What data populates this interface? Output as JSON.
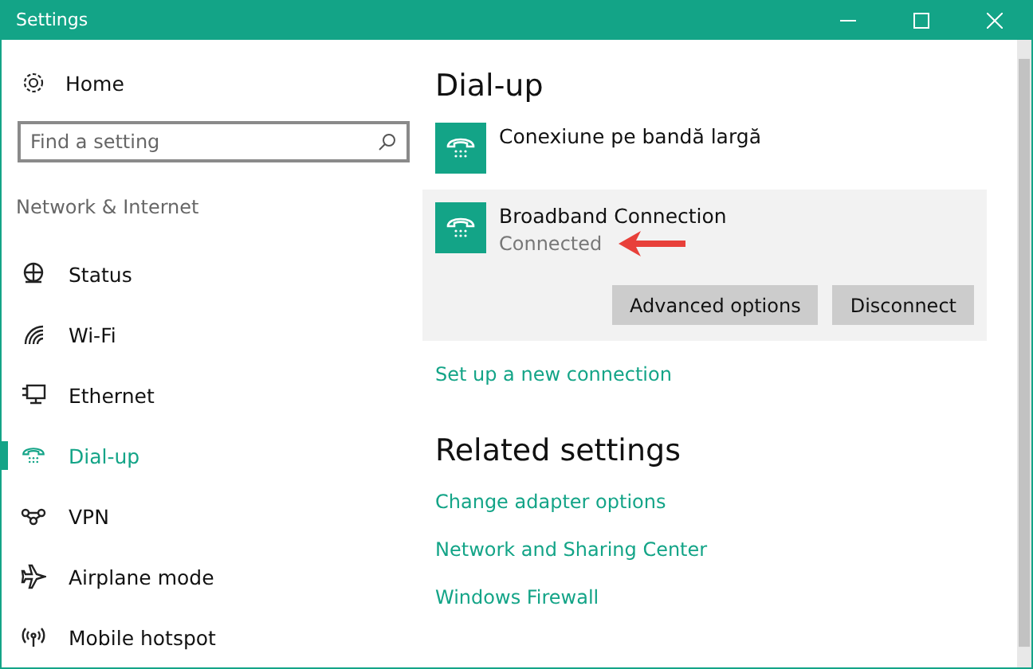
{
  "window": {
    "title": "Settings"
  },
  "sidebar": {
    "home": "Home",
    "search": {
      "placeholder": "Find a setting"
    },
    "section": "Network & Internet",
    "items": [
      {
        "label": "Status",
        "kind": "status",
        "selected": false
      },
      {
        "label": "Wi-Fi",
        "kind": "wifi",
        "selected": false
      },
      {
        "label": "Ethernet",
        "kind": "ethernet",
        "selected": false
      },
      {
        "label": "Dial-up",
        "kind": "dialup",
        "selected": true
      },
      {
        "label": "VPN",
        "kind": "vpn",
        "selected": false
      },
      {
        "label": "Airplane mode",
        "kind": "airplane",
        "selected": false
      },
      {
        "label": "Mobile hotspot",
        "kind": "hotspot",
        "selected": false
      }
    ]
  },
  "content": {
    "heading": "Dial-up",
    "connections": [
      {
        "name": "Conexiune pe bandă largă",
        "selected": false
      },
      {
        "name": "Broadband Connection",
        "status": "Connected",
        "selected": true,
        "buttons": [
          "Advanced options",
          "Disconnect"
        ]
      }
    ],
    "setup_link": "Set up a new connection",
    "related_heading": "Related settings",
    "related_links": [
      "Change adapter options",
      "Network and Sharing Center",
      "Windows Firewall"
    ]
  }
}
